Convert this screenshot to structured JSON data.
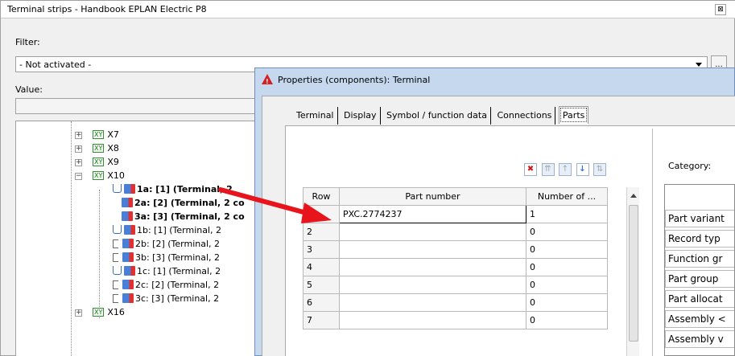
{
  "back_panel": {
    "title": "Terminal strips - Handbook EPLAN Electric P8",
    "close_glyph": "⊠",
    "filter_label": "Filter:",
    "filter_value": "- Not activated -",
    "filter_button": "...",
    "value_label": "Value:",
    "tree": [
      {
        "label": "X7",
        "kind": "strip"
      },
      {
        "label": "X8",
        "kind": "strip"
      },
      {
        "label": "X9",
        "kind": "strip"
      },
      {
        "label": "X10",
        "kind": "strip",
        "expanded": true
      },
      {
        "label": "1a: [1] (Terminal, 2",
        "kind": "terminal",
        "bold": true
      },
      {
        "label": "2a: [2] (Terminal, 2 co",
        "kind": "terminal",
        "bold": true
      },
      {
        "label": "3a: [3] (Terminal, 2 co",
        "kind": "terminal",
        "bold": true
      },
      {
        "label": "1b: [1] (Terminal, 2",
        "kind": "terminal"
      },
      {
        "label": "2b: [2] (Terminal, 2",
        "kind": "terminal"
      },
      {
        "label": "3b: [3] (Terminal, 2",
        "kind": "terminal"
      },
      {
        "label": "1c: [1] (Terminal, 2",
        "kind": "terminal"
      },
      {
        "label": "2c: [2] (Terminal, 2",
        "kind": "terminal"
      },
      {
        "label": "3c: [3] (Terminal, 2",
        "kind": "terminal"
      },
      {
        "label": "X16",
        "kind": "strip"
      }
    ],
    "xy_badge": "XY"
  },
  "dialog": {
    "title": "Properties (components): Terminal",
    "tabs": [
      "Terminal",
      "Display",
      "Symbol / function data",
      "Connections",
      "Parts"
    ],
    "active_tab": "Parts",
    "toolbar": {
      "delete": "✖",
      "top": "⇈",
      "up": "↑",
      "down": "↓",
      "sort": "⇅"
    },
    "grid": {
      "headers": [
        "Row",
        "Part number",
        "Number of ..."
      ],
      "rows": [
        {
          "row": "1",
          "part": "PXC.2774237",
          "count": "1"
        },
        {
          "row": "2",
          "part": "",
          "count": "0"
        },
        {
          "row": "3",
          "part": "",
          "count": "0"
        },
        {
          "row": "4",
          "part": "",
          "count": "0"
        },
        {
          "row": "5",
          "part": "",
          "count": "0"
        },
        {
          "row": "6",
          "part": "",
          "count": "0"
        },
        {
          "row": "7",
          "part": "",
          "count": "0"
        }
      ]
    },
    "category_label": "Category:",
    "categories": [
      "Part variant",
      "Record typ",
      "Function gr",
      "Part group",
      "Part allocat",
      "Assembly <",
      "Assembly v"
    ]
  }
}
